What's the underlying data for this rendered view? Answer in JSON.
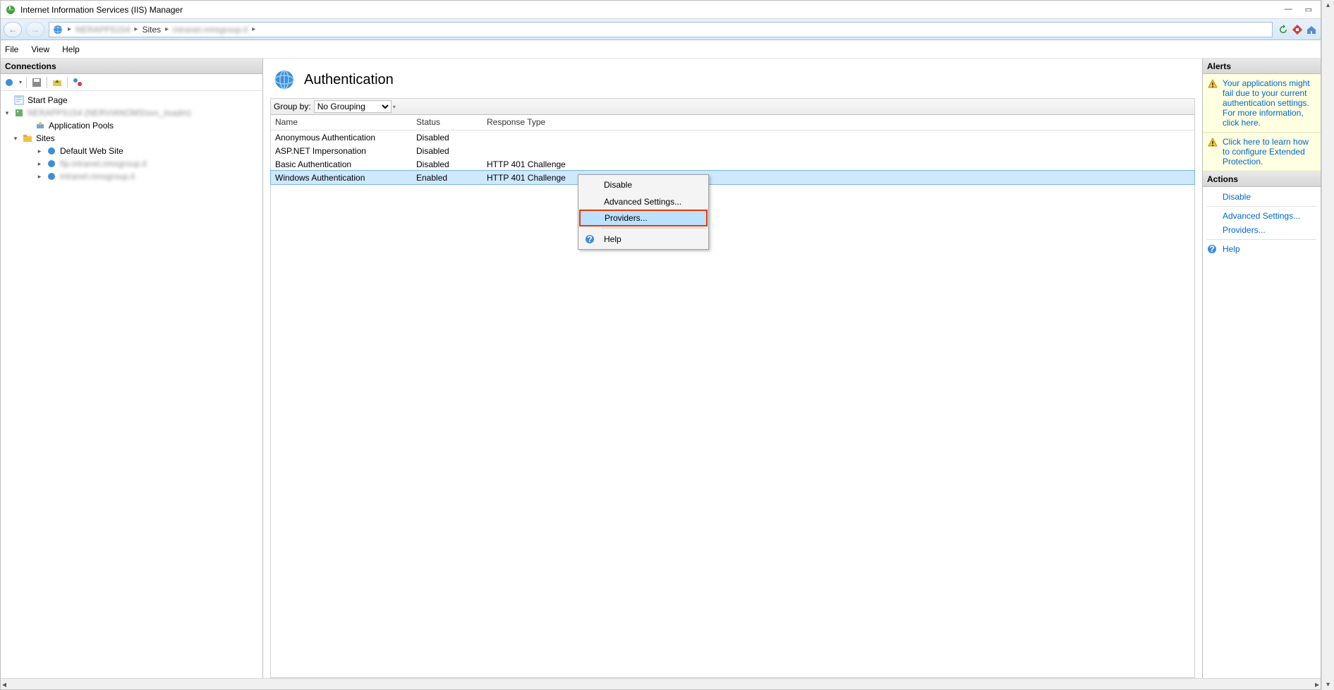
{
  "window": {
    "title": "Internet Information Services (IIS) Manager"
  },
  "breadcrumb": {
    "server": "NERAPPS154",
    "sites": "Sites",
    "site": "intranet.nmsgroup.it"
  },
  "menu": {
    "file": "File",
    "view": "View",
    "help": "Help"
  },
  "connections": {
    "header": "Connections",
    "tree": {
      "start_page": "Start Page",
      "server": "NERAPPS154 (NERVIANOMS\\svc_iisadm)",
      "app_pools": "Application Pools",
      "sites": "Sites",
      "default_site": "Default Web Site",
      "site_blur1": "ftp.intranet.nmsgroup.it",
      "site_blur2": "intranet.nmsgroup.it"
    }
  },
  "center": {
    "title": "Authentication",
    "group_by_label": "Group by:",
    "group_by_value": "No Grouping",
    "columns": {
      "name": "Name",
      "status": "Status",
      "response": "Response Type"
    },
    "rows": [
      {
        "name": "Anonymous Authentication",
        "status": "Disabled",
        "response": ""
      },
      {
        "name": "ASP.NET Impersonation",
        "status": "Disabled",
        "response": ""
      },
      {
        "name": "Basic Authentication",
        "status": "Disabled",
        "response": "HTTP 401 Challenge"
      },
      {
        "name": "Windows Authentication",
        "status": "Enabled",
        "response": "HTTP 401 Challenge"
      }
    ]
  },
  "context_menu": {
    "disable": "Disable",
    "advanced": "Advanced Settings...",
    "providers": "Providers...",
    "help": "Help"
  },
  "alerts": {
    "header": "Alerts",
    "alert1": "Your applications might fail due to your current authentication settings.  For more information, click here.",
    "alert2": "Click here to learn how to configure Extended Protection."
  },
  "actions": {
    "header": "Actions",
    "disable": "Disable",
    "advanced": "Advanced Settings...",
    "providers": "Providers...",
    "help": "Help"
  }
}
